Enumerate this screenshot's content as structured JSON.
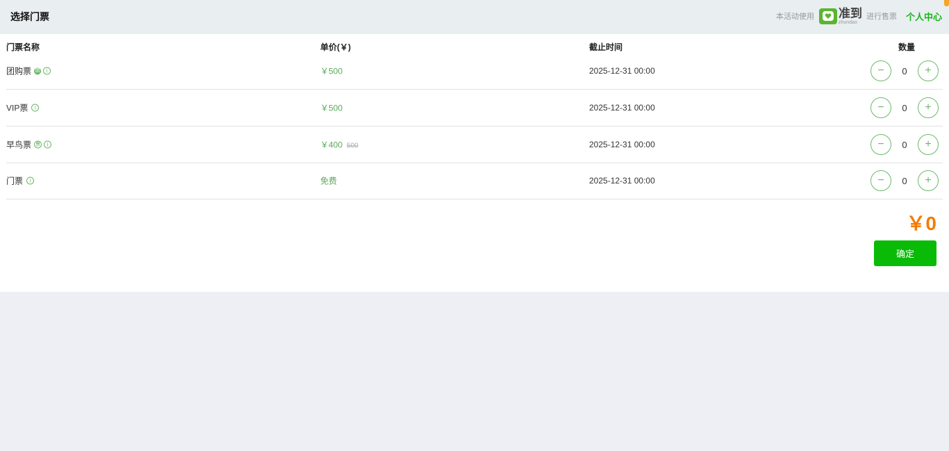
{
  "header": {
    "title": "选择门票",
    "powered_prefix": "本活动使用",
    "brand_cn": "准到",
    "brand_en": "zhundao",
    "powered_suffix": "进行售票",
    "user_center": "个人中心"
  },
  "table": {
    "headers": {
      "name": "门票名称",
      "price": "单价(￥)",
      "deadline": "截止时间",
      "quantity": "数量"
    },
    "tickets": [
      {
        "name": "团购票",
        "badge": "团",
        "price": "￥500",
        "original_price": "",
        "deadline": "2025-12-31 00:00",
        "quantity": "0"
      },
      {
        "name": "VIP票",
        "badge": "",
        "price": "￥500",
        "original_price": "",
        "deadline": "2025-12-31 00:00",
        "quantity": "0"
      },
      {
        "name": "早鸟票",
        "badge": "惠",
        "price": "￥400",
        "original_price": "500",
        "deadline": "2025-12-31 00:00",
        "quantity": "0"
      },
      {
        "name": "门票",
        "badge": "",
        "price": "免费",
        "original_price": "",
        "deadline": "2025-12-31 00:00",
        "quantity": "0"
      }
    ],
    "minus_symbol": "−",
    "plus_symbol": "+",
    "info_symbol": "i"
  },
  "summary": {
    "total": "￥0",
    "confirm_label": "确定"
  },
  "colors": {
    "accent_green": "#09bb07",
    "price_green": "#5aa95a",
    "total_orange": "#f47b00"
  }
}
